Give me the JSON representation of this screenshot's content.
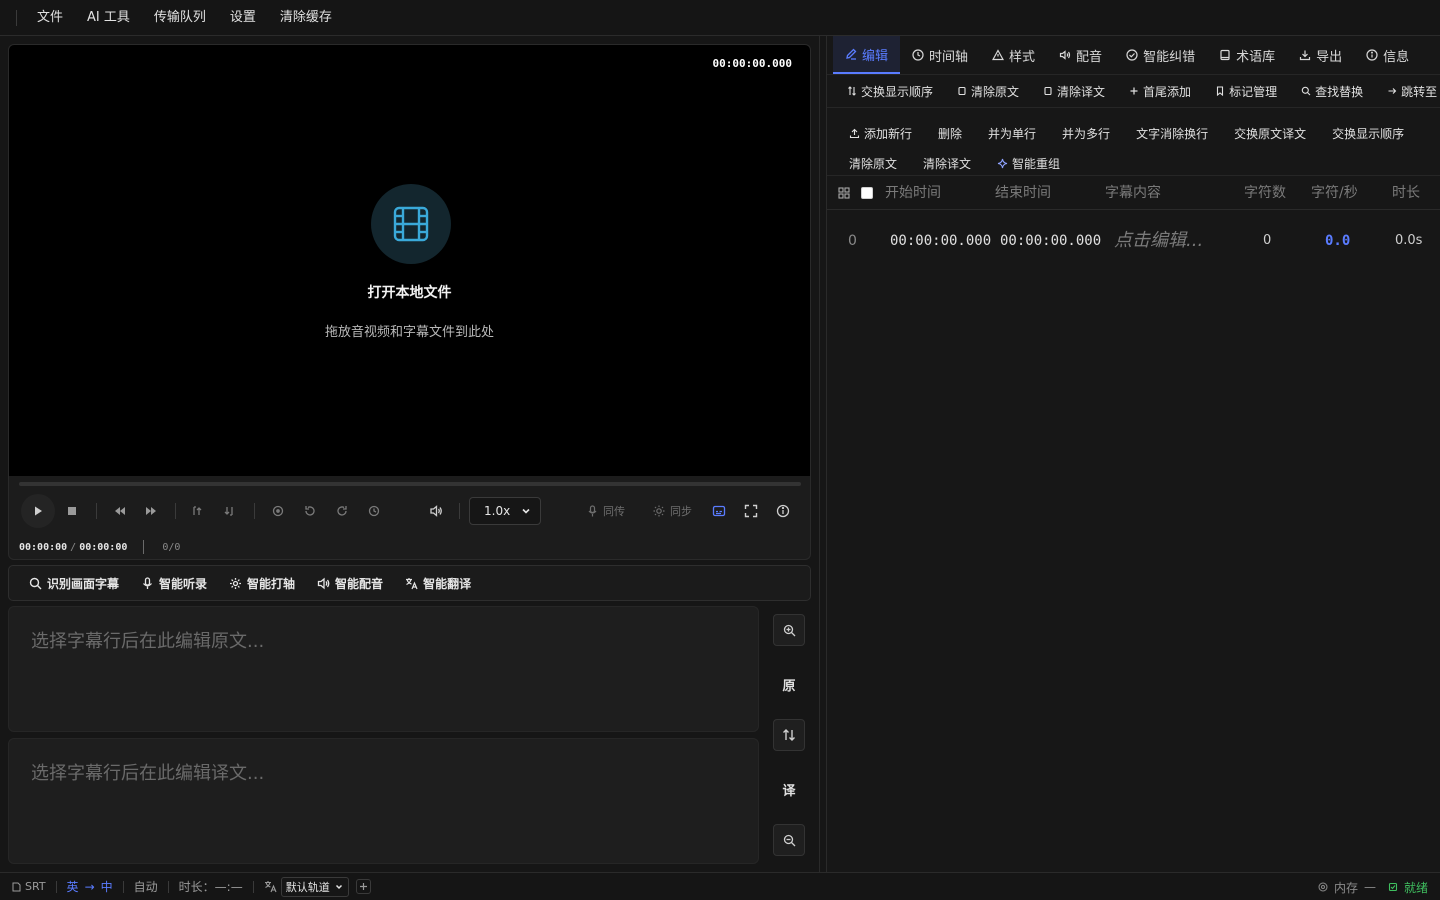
{
  "menu": {
    "items": [
      "文件",
      "AI 工具",
      "传输队列",
      "设置",
      "清除缓存"
    ]
  },
  "player": {
    "timecode_top": "00:00:00.000",
    "open_title": "打开本地文件",
    "open_subtitle": "拖放音视频和字幕文件到此处",
    "speed": "1.0x",
    "dub_label": "同传",
    "sync_label": "同步",
    "current_time": "00:00:00",
    "total_time": "00:00:00",
    "frames": "0/0"
  },
  "ai_tools": {
    "items": [
      "识别画面字幕",
      "智能听录",
      "智能打轴",
      "智能配音",
      "智能翻译"
    ]
  },
  "editor": {
    "original_placeholder": "选择字幕行后在此编辑原文...",
    "translation_placeholder": "选择字幕行后在此编辑译文...",
    "original_label": "原",
    "translation_label": "译"
  },
  "right_panel": {
    "tabs": [
      "编辑",
      "时间轴",
      "样式",
      "配音",
      "智能纠错",
      "术语库",
      "导出",
      "信息"
    ],
    "toolbar1": [
      "交换显示顺序",
      "清除原文",
      "清除译文",
      "首尾添加",
      "标记管理",
      "查找替换",
      "跳转至"
    ],
    "toolbar2": [
      "添加新行",
      "删除",
      "并为单行",
      "并为多行",
      "文字消除换行",
      "交换原文译文",
      "交换显示顺序",
      "清除原文",
      "清除译文",
      "智能重组"
    ],
    "columns": [
      "开始时间",
      "结束时间",
      "字幕内容",
      "字符数",
      "字符/秒",
      "时长"
    ],
    "rows": [
      {
        "index": "0",
        "start": "00:00:00.000",
        "end": "00:00:00.000",
        "content": "点击编辑...",
        "chars": "0",
        "cps": "0.0",
        "duration": "0.0s"
      }
    ]
  },
  "status": {
    "format": "SRT",
    "lang_from": "英",
    "arrow": "→",
    "lang_to": "中",
    "mode": "自动",
    "duration_label": "时长：",
    "duration_value": "—:—",
    "track": "默认轨道",
    "memory": "内存",
    "memory_value": "—",
    "ready": "就绪"
  },
  "colors": {
    "accent": "#5a7cff",
    "ready_green": "#3fbf5f",
    "film_icon": "#3aa9d9"
  }
}
